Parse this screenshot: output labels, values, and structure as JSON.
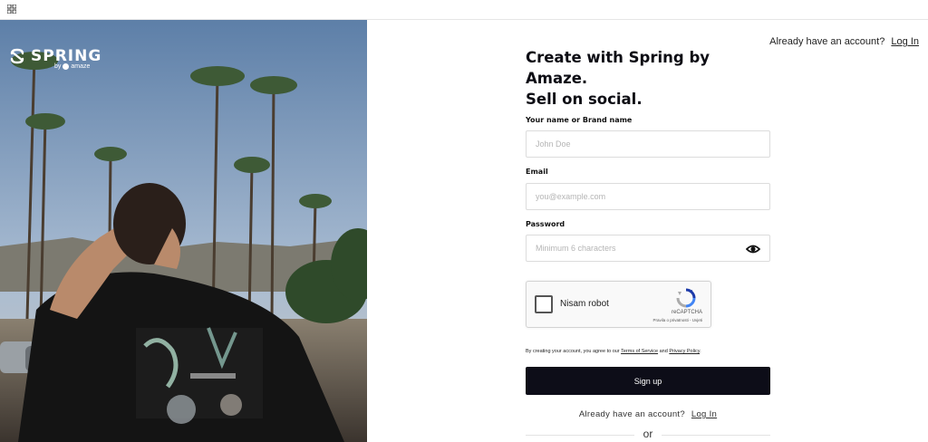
{
  "brand": {
    "name": "SPRING",
    "by": "by",
    "parent": "amaze"
  },
  "header": {
    "login_prompt": "Already have an account?",
    "login_link": "Log In"
  },
  "form": {
    "headline_line1": "Create with Spring by Amaze.",
    "headline_line2": "Sell on social.",
    "name_label": "Your name or Brand name",
    "name_placeholder": "John Doe",
    "email_label": "Email",
    "email_placeholder": "you@example.com",
    "password_label": "Password",
    "password_placeholder": "Minimum 6 characters",
    "password_toggle_icon": "eye-icon",
    "captcha": {
      "checkbox_label": "Nisam robot",
      "brand": "reCAPTCHA",
      "links": "Pravila o privatnosti - Uvjeti"
    },
    "terms_prefix": "By creating your account, you agree to our",
    "terms_link": "Terms of Service",
    "terms_and": "and",
    "privacy_link": "Privacy Policy",
    "terms_suffix": ".",
    "signup_button": "Sign up",
    "bottom_login_prompt": "Already have an account?",
    "bottom_login_link": "Log In",
    "or_text": "or"
  },
  "colors": {
    "primary_button": "#0d0d18",
    "text": "#111111",
    "border": "#dcdcdc"
  }
}
